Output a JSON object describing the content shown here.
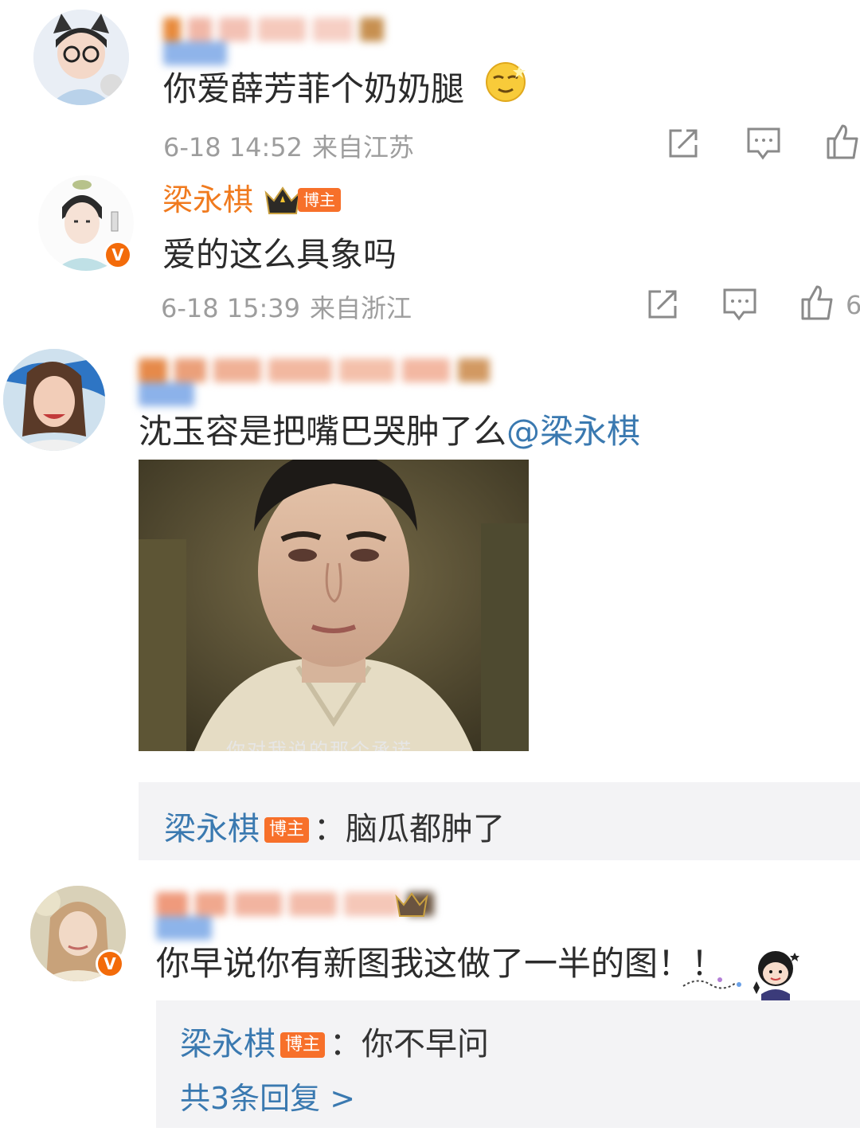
{
  "comments": [
    {
      "text": "你爱薛芳菲个奶奶腿",
      "time": "6-18 14:52",
      "location": "来自江苏"
    },
    {
      "username": "梁永棋",
      "tag": "博主",
      "text": "爱的这么具象吗",
      "time": "6-18 15:39",
      "location": "来自浙江",
      "likes": "6"
    },
    {
      "text_before": "沈玉容是把嘴巴哭肿了么",
      "mention": "@梁永棋",
      "image_caption": "你对我说的那个承诺",
      "reply": {
        "name": "梁永棋",
        "tag": "博主",
        "text": "：脑瓜都肿了"
      }
    },
    {
      "text": "你早说你有新图我这做了一半的图！！",
      "reply": {
        "name": "梁永棋",
        "tag": "博主",
        "text": "：你不早问"
      },
      "more_replies": "共3条回复 >"
    }
  ],
  "colors": {
    "username": "#f07a1e",
    "tag": "#f7702a",
    "link": "#3a79b0",
    "meta": "#9d9d9d",
    "reply_bg": "#f3f3f5"
  }
}
